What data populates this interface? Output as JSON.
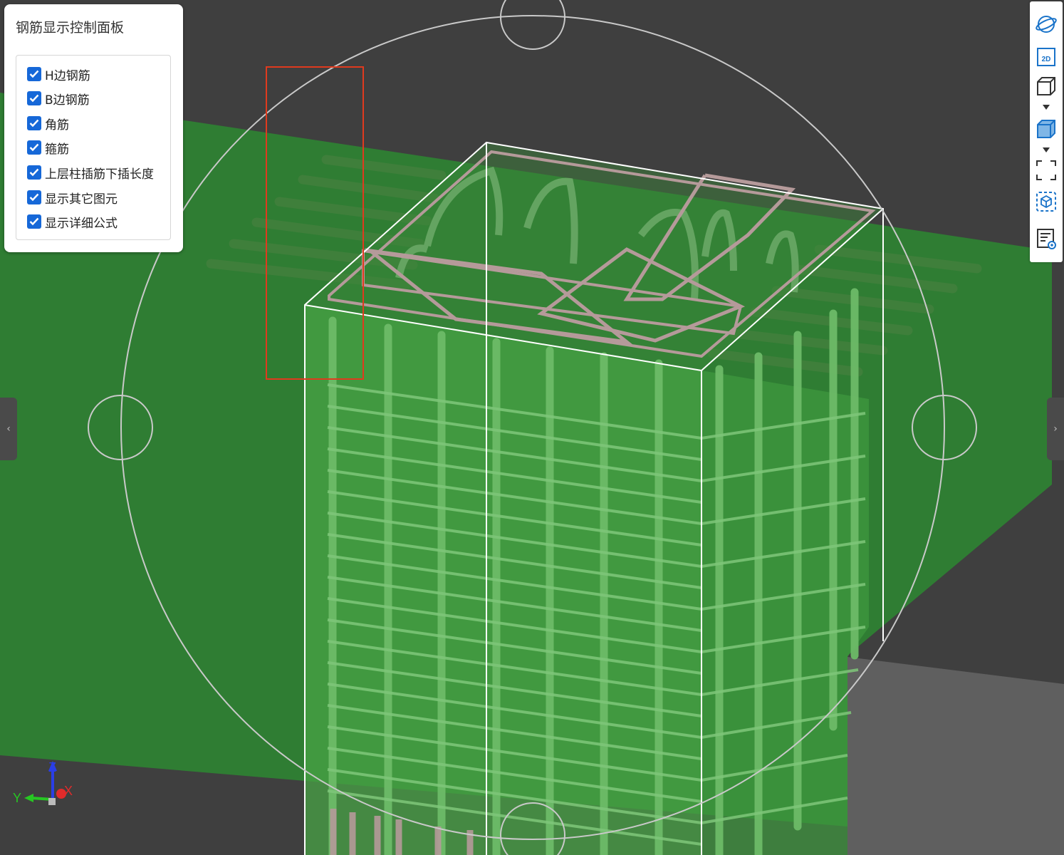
{
  "panel": {
    "title": "钢筋显示控制面板",
    "options": [
      {
        "label": "H边钢筋",
        "checked": true
      },
      {
        "label": "B边钢筋",
        "checked": true
      },
      {
        "label": "角筋",
        "checked": true
      },
      {
        "label": "箍筋",
        "checked": true
      },
      {
        "label": "上层柱插筋下插长度",
        "checked": true
      },
      {
        "label": "显示其它图元",
        "checked": true
      },
      {
        "label": "显示详细公式",
        "checked": true
      }
    ]
  },
  "toolbar": {
    "buttons": [
      {
        "name": "orbit-icon"
      },
      {
        "name": "view-2d-icon",
        "text": "2D"
      },
      {
        "name": "wireframe-cube-icon"
      },
      {
        "name": "solid-cube-icon"
      },
      {
        "name": "fit-view-icon"
      },
      {
        "name": "isolate-view-icon"
      },
      {
        "name": "properties-view-icon"
      }
    ]
  },
  "axes": {
    "x": "X",
    "y": "Y",
    "z": "Z"
  },
  "colors": {
    "background": "#3f3f3f",
    "beam": "#2f7d33",
    "column": "#4aa446",
    "rebar": "#6dbb68",
    "stirrup_top": "#b59a9a",
    "highlight_box": "#e03a1e",
    "checkbox": "#1668d8"
  }
}
